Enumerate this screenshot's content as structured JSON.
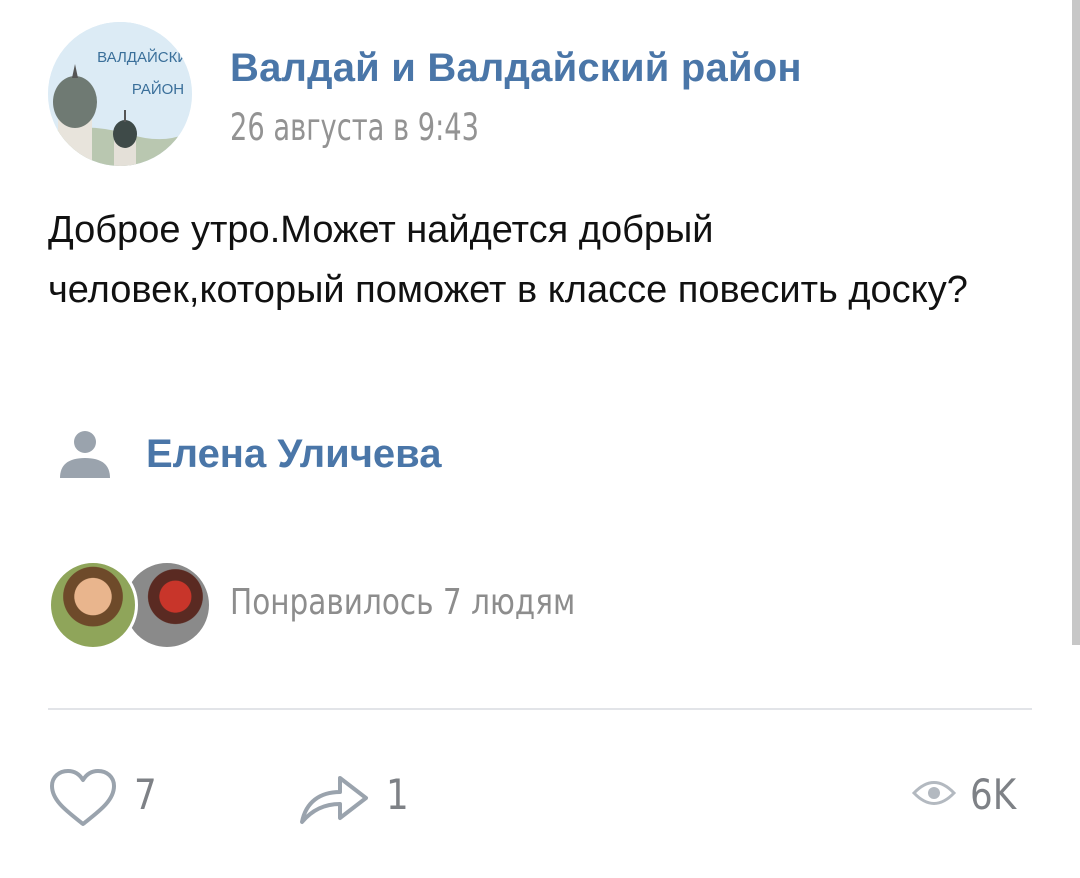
{
  "post": {
    "group_name": "Валдай и Валдайский район",
    "date": "26 августа в 9:43",
    "avatar_text": [
      "ВАЛДАЙСКИЙ",
      "РАЙОН"
    ],
    "text": "Доброе утро.Может найдется добрый человек,который поможет в классе повесить доску?",
    "author_name": "Елена Уличева",
    "likes_text": "Понравилось 7 людям"
  },
  "actions": {
    "likes_count": "7",
    "shares_count": "1",
    "views_count": "6K"
  },
  "icons": {
    "like": "heart-icon",
    "share": "share-arrow-icon",
    "views": "eye-icon",
    "author": "person-icon"
  },
  "colors": {
    "link": "#4a76a8",
    "muted": "#939393",
    "icon": "#9aa3ad"
  }
}
